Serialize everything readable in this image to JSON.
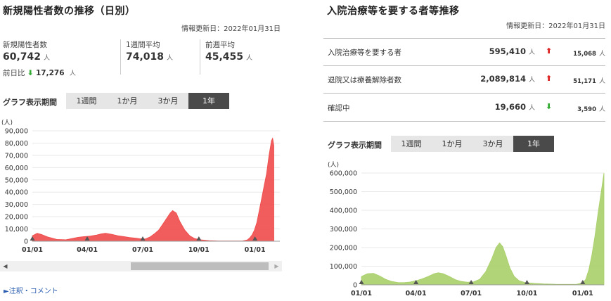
{
  "left": {
    "title": "新規陽性者数の推移（日別）",
    "updated": "情報更新日：2022年01月31日",
    "stats": [
      {
        "label": "新規陽性者数",
        "value": "60,742",
        "unit": "人"
      },
      {
        "label": "1週間平均",
        "value": "74,018",
        "unit": "人"
      },
      {
        "label": "前週平均",
        "value": "45,455",
        "unit": "人"
      }
    ],
    "prev_day": {
      "label": "前日比",
      "value": "17,276",
      "unit": "人",
      "arrow": "⬇"
    },
    "period_label": "グラフ表示期間",
    "tabs": [
      "1週間",
      "1か月",
      "3か月",
      "1年"
    ],
    "active_tab": 3,
    "notes_link": "►注釈・コメント",
    "scroll_left": "◀",
    "scroll_right": "▶"
  },
  "right": {
    "title": "入院治療等を要する者等推移",
    "updated": "情報更新日：2022年01月31日",
    "rows": [
      {
        "label": "入院治療等を要する者",
        "value": "595,410",
        "unit": "人",
        "arrow": "⬆",
        "dir": "up",
        "diff": "15,068",
        "diff_unit": "人"
      },
      {
        "label": "退院又は療養解除者数",
        "value": "2,089,814",
        "unit": "人",
        "arrow": "⬆",
        "dir": "up",
        "diff": "51,171",
        "diff_unit": "人"
      },
      {
        "label": "確認中",
        "value": "19,660",
        "unit": "人",
        "arrow": "⬇",
        "dir": "down",
        "diff": "3,590",
        "diff_unit": "人"
      }
    ],
    "period_label": "グラフ表示期間",
    "tabs": [
      "1週間",
      "1か月",
      "3か月",
      "1年"
    ],
    "active_tab": 3
  },
  "colors": {
    "left_series": "#ef4a4a",
    "right_series": "#a9cf6a",
    "up": "#dd2222",
    "down": "#33aa33"
  },
  "chart_data": [
    {
      "type": "area",
      "ylabel": "(人)",
      "ylim": [
        0,
        90000
      ],
      "yticks": [
        0,
        10000,
        20000,
        30000,
        40000,
        50000,
        60000,
        70000,
        80000,
        90000
      ],
      "ytick_labels": [
        "0",
        "10,000",
        "20,000",
        "30,000",
        "40,000",
        "50,000",
        "60,000",
        "70,000",
        "80,000",
        "90,000"
      ],
      "xticks": [
        "01/01",
        "04/01",
        "07/01",
        "10/01",
        "01/01"
      ],
      "xtick_days": [
        0,
        90,
        181,
        273,
        365
      ],
      "grid": true,
      "series": [
        {
          "x": [
            0,
            8,
            15,
            25,
            40,
            55,
            65,
            75,
            85,
            95,
            105,
            113,
            120,
            130,
            140,
            150,
            160,
            170,
            180,
            186,
            193,
            200,
            207,
            214,
            218,
            222,
            226,
            230,
            236,
            242,
            250,
            258,
            266,
            275,
            290,
            305,
            320,
            335,
            345,
            352,
            356,
            360,
            364,
            368,
            372,
            376,
            380,
            384,
            388,
            392,
            394,
            396
          ],
          "y": [
            4500,
            6500,
            5500,
            3500,
            1500,
            1200,
            2200,
            3200,
            3800,
            4200,
            5000,
            6000,
            6500,
            5700,
            4500,
            3800,
            3000,
            2500,
            1800,
            2000,
            3500,
            6000,
            9000,
            14000,
            17000,
            20000,
            23000,
            25000,
            23000,
            16000,
            9000,
            4500,
            2200,
            1200,
            500,
            250,
            150,
            150,
            300,
            1000,
            2500,
            5000,
            9000,
            15000,
            25000,
            35000,
            45000,
            55000,
            70000,
            82000,
            84000,
            78000
          ]
        }
      ]
    },
    {
      "type": "area",
      "ylabel": "(人)",
      "ylim": [
        0,
        600000
      ],
      "yticks": [
        0,
        100000,
        200000,
        300000,
        400000,
        500000,
        600000
      ],
      "ytick_labels": [
        "0",
        "100,000",
        "200,000",
        "300,000",
        "400,000",
        "500,000",
        "600,000"
      ],
      "xticks": [
        "01/01",
        "04/01",
        "07/01",
        "10/01",
        "01/01"
      ],
      "xtick_days": [
        0,
        90,
        181,
        273,
        365
      ],
      "grid": true,
      "series": [
        {
          "x": [
            0,
            10,
            20,
            30,
            40,
            50,
            60,
            70,
            80,
            90,
            100,
            110,
            120,
            127,
            135,
            145,
            155,
            165,
            175,
            185,
            195,
            205,
            215,
            222,
            228,
            233,
            238,
            245,
            252,
            260,
            270,
            285,
            300,
            320,
            340,
            355,
            365,
            370,
            375,
            380,
            385,
            390,
            395,
            400
          ],
          "y": [
            45000,
            60000,
            62000,
            48000,
            30000,
            18000,
            13000,
            12000,
            15000,
            22000,
            32000,
            45000,
            60000,
            65000,
            60000,
            45000,
            28000,
            18000,
            14000,
            16000,
            30000,
            70000,
            140000,
            200000,
            225000,
            205000,
            160000,
            90000,
            45000,
            22000,
            12000,
            8000,
            5000,
            3000,
            2500,
            3000,
            10000,
            30000,
            80000,
            160000,
            260000,
            380000,
            490000,
            600000
          ]
        }
      ]
    }
  ]
}
